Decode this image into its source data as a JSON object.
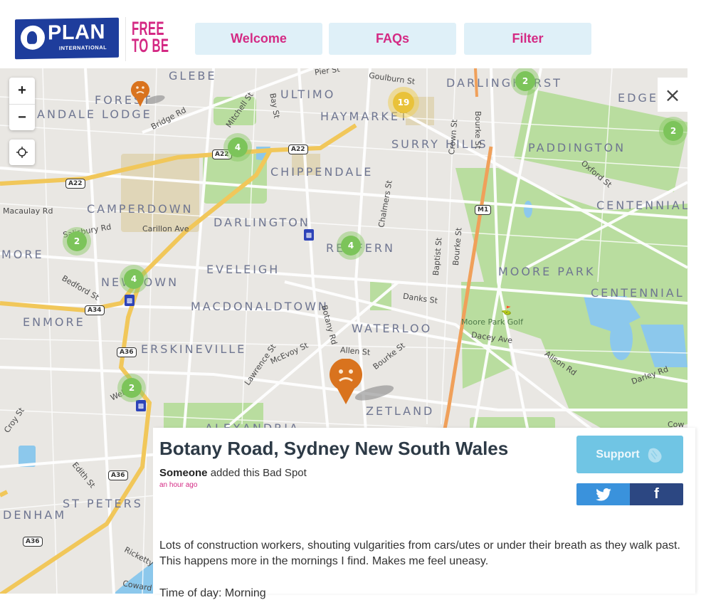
{
  "header": {
    "logo": {
      "name": "PLAN",
      "subtitle": "INTERNATIONAL",
      "icon": "plan-emblem-icon"
    },
    "campaign": {
      "line1": "FREE",
      "line2": "TO BE"
    },
    "nav": [
      {
        "label": "Welcome"
      },
      {
        "label": "FAQs"
      },
      {
        "label": "Filter"
      }
    ]
  },
  "colors": {
    "brand_pink": "#d42a84",
    "plan_blue": "#1e3d9c",
    "nav_bg": "#dff0f8",
    "support_bg": "#70c5e4",
    "twitter": "#3a92dc",
    "facebook": "#2c4782",
    "pin_orange": "#d9731e",
    "cluster_green": "#7cc45a",
    "cluster_yellow": "#e9c23a"
  },
  "map": {
    "controls": {
      "zoom_in": "+",
      "zoom_out": "−",
      "locate_icon": "crosshair-icon",
      "close": "×"
    },
    "areas": [
      "GLEBE",
      "FOREST",
      "ANDALE LODGE",
      "ULTIMO",
      "HAYMARKET",
      "DARLINGHURST",
      "EDGECLIFF",
      "SURRY HILLS",
      "PADDINGTON",
      "CHIPPENDALE",
      "CAMPERDOWN",
      "DARLINGTON",
      "REDFERN",
      "CENTENNIAL SQUARE",
      "MORE",
      "EVELEIGH",
      "NEWTOWN",
      "MOORE PARK",
      "CENTENNIAL PARK",
      "MACDONALDTOWN",
      "ENMORE",
      "WATERLOO",
      "ERSKINEVILLE",
      "ZETLAND",
      "ALEXANDRIA",
      "ST PETERS",
      "DENHAM"
    ],
    "streets": [
      "Pier St",
      "Goulburn St",
      "Bridge Rd",
      "Mitchell St",
      "Bay St",
      "Crown St",
      "Bourke St",
      "Oxford St",
      "Macaulay Rd",
      "Salisbury Rd",
      "Carillon Ave",
      "Chalmers St",
      "Baptist St",
      "Bourke St",
      "Bedford St",
      "Danks St",
      "Botany Rd",
      "Dacey Ave",
      "Allen St",
      "Bourke St",
      "McEvoy St",
      "Lawrence St",
      "Alison Rd",
      "Darley Rd",
      "Wells St",
      "Edith St",
      "Ricketty St",
      "Coward St",
      "Croy St",
      "Cow"
    ],
    "parks": [
      "Moore Park Golf"
    ],
    "road_shields": [
      "A22",
      "A22",
      "A22",
      "M1",
      "A34",
      "A36",
      "A36",
      "A36"
    ],
    "clusters": [
      {
        "count": "19",
        "color": "yellow"
      },
      {
        "count": "2",
        "color": "green"
      },
      {
        "count": "2",
        "color": "green"
      },
      {
        "count": "4",
        "color": "green"
      },
      {
        "count": "4",
        "color": "green"
      },
      {
        "count": "2",
        "color": "green"
      },
      {
        "count": "4",
        "color": "green"
      },
      {
        "count": "2",
        "color": "green"
      }
    ],
    "pins": [
      {
        "type": "bad-spot",
        "icon": "sad-face-icon"
      },
      {
        "type": "bad-spot",
        "icon": "sad-face-icon",
        "selected": true
      }
    ]
  },
  "spot": {
    "title": "Botany Road, Sydney New South Wales",
    "author": "Someone",
    "action": "added this Bad Spot",
    "time_ago": "an hour ago",
    "description": "Lots of construction workers, shouting vulgarities from cars/utes or under their breath as they walk past. This happens more in the mornings I find. Makes me feel uneasy.",
    "time_of_day": "Time of day: Morning",
    "support_label": "Support",
    "share": {
      "twitter_icon": "twitter-icon",
      "facebook_label": "f"
    }
  }
}
